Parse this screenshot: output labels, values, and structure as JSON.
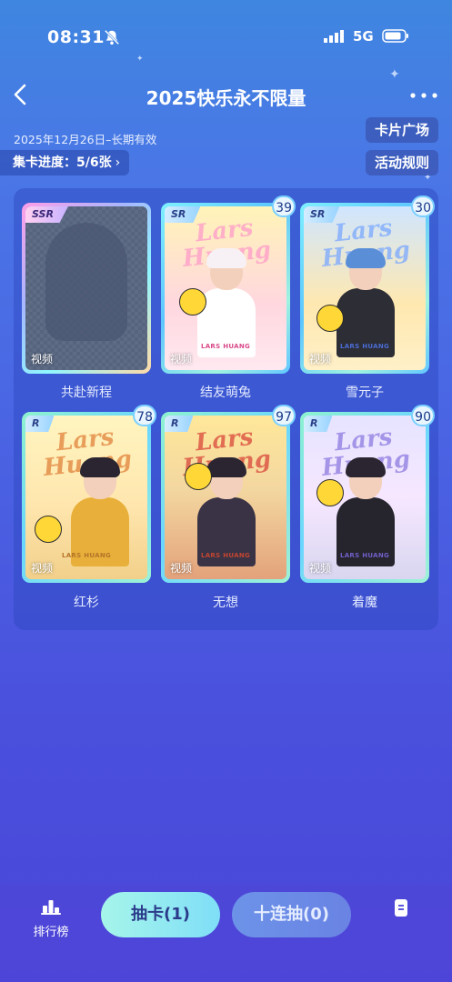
{
  "status_bar": {
    "time": "08:31",
    "network": "5G"
  },
  "header": {
    "title": "2025快乐永不限量"
  },
  "info": {
    "validity": "2025年12月26日–长期有效",
    "progress_label": "集卡进度：",
    "progress_value": "5/6张",
    "progress_fraction": 0.8333,
    "card_square": "卡片广场",
    "rules": "活动规则"
  },
  "cards": [
    {
      "rarity": "SSR",
      "name": "共赴新程",
      "video": "视频",
      "count": "",
      "locked": true
    },
    {
      "rarity": "SR",
      "name": "结友萌兔",
      "video": "视频",
      "count": "39",
      "locked": false,
      "logo": "Lars Huang",
      "plate": "LARS HUANG"
    },
    {
      "rarity": "SR",
      "name": "雪元子",
      "video": "视频",
      "count": "30",
      "locked": false,
      "logo": "Lars Huang",
      "plate": "LARS HUANG"
    },
    {
      "rarity": "R",
      "name": "红杉",
      "video": "视频",
      "count": "78",
      "locked": false,
      "logo": "Lars Huang",
      "plate": "LARS HUANG"
    },
    {
      "rarity": "R",
      "name": "无想",
      "video": "视频",
      "count": "97",
      "locked": false,
      "logo": "Lars Huang",
      "plate": "LARS HUANG"
    },
    {
      "rarity": "R",
      "name": "着魔",
      "video": "视频",
      "count": "90",
      "locked": false,
      "logo": "Lars Huang",
      "plate": "LARS HUANG"
    }
  ],
  "bottom": {
    "rank_label": "排行榜",
    "draw_one": "抽卡(1)",
    "draw_ten": "十连抽(0)"
  },
  "icons": [
    "bell-off-icon",
    "signal-icon",
    "battery-icon",
    "back-icon",
    "more-icon",
    "chevron-right-icon",
    "leaderboard-icon",
    "document-icon"
  ]
}
